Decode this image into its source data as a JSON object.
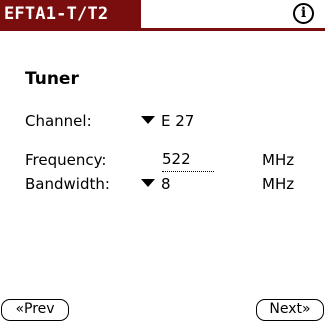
{
  "colors": {
    "title_background": "#7a0d0d",
    "title_text": "#ffffff",
    "background": "#ffffff",
    "text": "#000000"
  },
  "header": {
    "title": "EFTA1-T/T2",
    "info_icon": "info-icon"
  },
  "form": {
    "section_title": "Tuner",
    "channel": {
      "label": "Channel:",
      "value": "E 27",
      "icon": "dropdown-arrow-icon"
    },
    "frequency": {
      "label": "Frequency:",
      "value": "522",
      "unit": "MHz"
    },
    "bandwidth": {
      "label": "Bandwidth:",
      "value": "8",
      "unit": "MHz",
      "icon": "dropdown-arrow-icon"
    }
  },
  "footer": {
    "prev_label": "«Prev",
    "next_label": "Next»"
  }
}
